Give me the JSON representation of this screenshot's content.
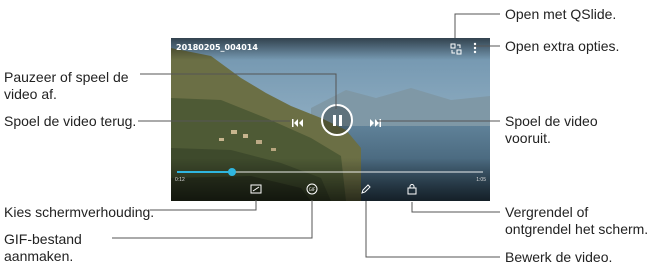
{
  "video": {
    "file_name": "20180205_004014",
    "progress": 0.18,
    "time_current": "0:12",
    "time_total": "1:05"
  },
  "callouts": {
    "pause_play": "Pauzeer of speel de\nvideo af.",
    "rewind": "Spoel de video terug.",
    "aspect_ratio": "Kies schermverhouding.",
    "gif": "GIF-bestand\naanmaken.",
    "qslide": "Open met QSlide.",
    "more_options": "Open extra opties.",
    "forward": "Spoel de video\nvooruit.",
    "lock": "Vergrendel of\nontgrendel het scherm.",
    "edit": "Bewerk de video."
  },
  "icons": {
    "qslide": "qslide-icon",
    "more": "more-options-icon",
    "pause": "pause-icon",
    "rewind": "rewind-icon",
    "forward": "fast-forward-icon",
    "aspect": "aspect-ratio-icon",
    "gif": "gif-icon",
    "edit": "pencil-icon",
    "lock": "lock-icon"
  },
  "colors": {
    "accent": "#2fb6e0",
    "label_text": "#222222",
    "leader_line": "#555555"
  }
}
